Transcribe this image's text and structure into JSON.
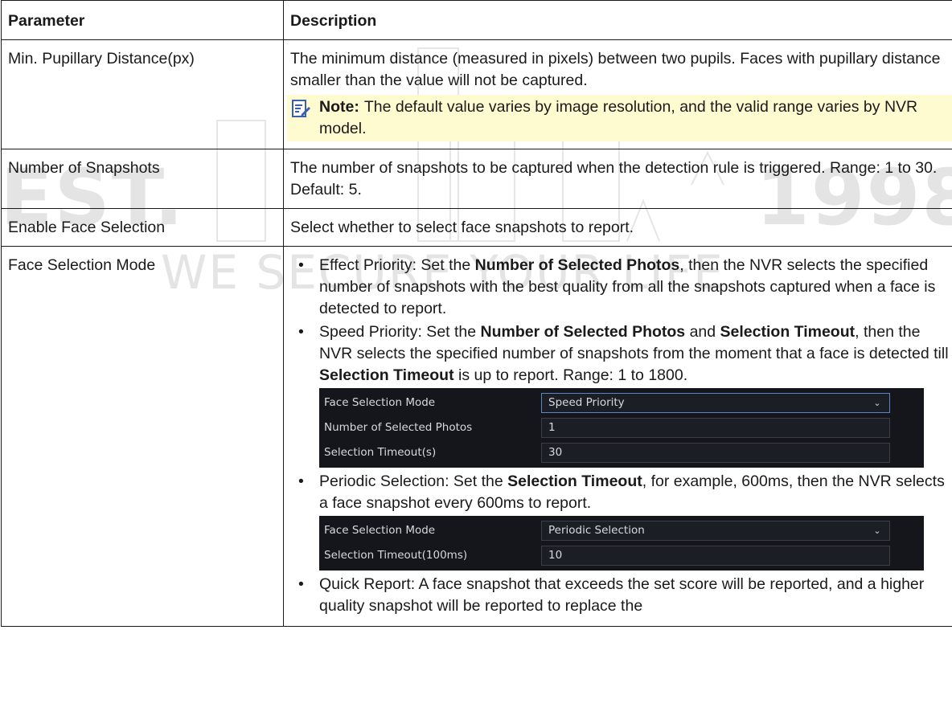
{
  "header": {
    "parameter": "Parameter",
    "description": "Description"
  },
  "rows": [
    {
      "param": "Min. Pupillary Distance(px)",
      "desc": "The minimum distance (measured in pixels) between two pupils. Faces with pupillary distance smaller than the value will not be captured.",
      "note_label": "Note:",
      "note_text": "The default value varies by image resolution, and the valid range varies by NVR model."
    },
    {
      "param": "Number of Snapshots",
      "desc": "The number of snapshots to be captured when the detection rule is triggered. Range: 1 to 30. Default: 5."
    },
    {
      "param": "Enable Face Selection",
      "desc": "Select whether to select face snapshots to report."
    },
    {
      "param": "Face Selection Mode",
      "bullets": {
        "effect": {
          "pre": "Effect Priority: Set the ",
          "b1": "Number of Selected Photos",
          "post": ", then the NVR selects the specified number of snapshots with the best quality from all the snapshots captured when a face is detected to report."
        },
        "speed": {
          "pre": "Speed Priority: Set the ",
          "b1": "Number of Selected Photos",
          "mid": " and ",
          "b2": "Selection Timeout",
          "mid2": ", then the NVR selects the specified number of snapshots from the moment that a face is detected till ",
          "b3": "Selection Timeout",
          "post": " is up to report. Range: 1 to 1800."
        },
        "periodic": {
          "pre": "Periodic Selection: Set the ",
          "b1": "Selection Timeout",
          "post": ", for example, 600ms, then the NVR selects a face snapshot every 600ms to report."
        },
        "quick": {
          "text": "Quick Report: A face snapshot that exceeds the set score will be reported, and a higher quality snapshot will be reported to replace the"
        }
      },
      "speed_ui": {
        "mode_label": "Face Selection Mode",
        "mode_value": "Speed Priority",
        "photos_label": "Number of Selected Photos",
        "photos_value": "1",
        "timeout_label": "Selection Timeout(s)",
        "timeout_value": "30"
      },
      "periodic_ui": {
        "mode_label": "Face Selection Mode",
        "mode_value": "Periodic Selection",
        "timeout_label": "Selection Timeout(100ms)",
        "timeout_value": "10"
      }
    }
  ],
  "watermark": {
    "line1": "WE SECURE YOUR LIFE",
    "est": "EST.",
    "year": "1998"
  }
}
